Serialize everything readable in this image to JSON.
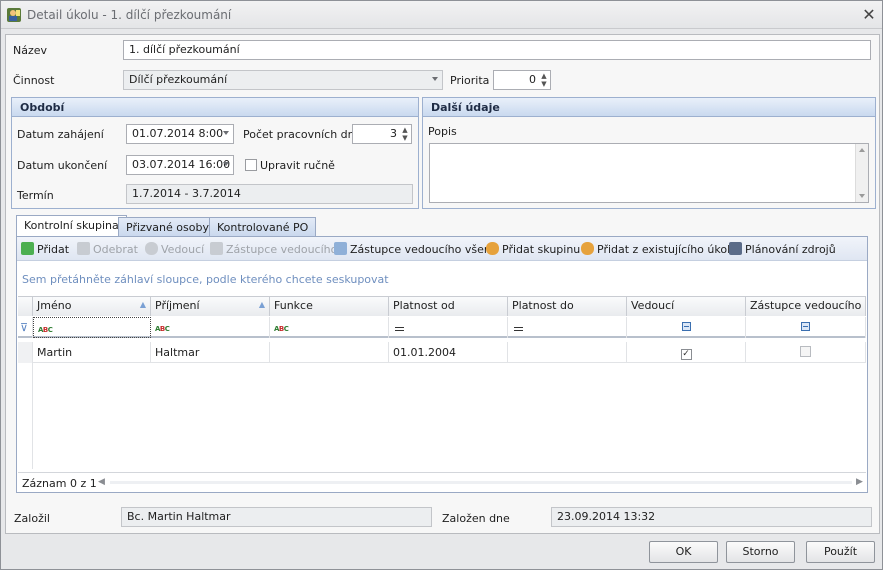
{
  "window": {
    "title": "Detail úkolu - 1. dílčí přezkoumání"
  },
  "form": {
    "nazev_label": "Název",
    "nazev_value": "1. dílčí přezkoumání",
    "cinnost_label": "Činnost",
    "cinnost_value": "Dílčí přezkoumání",
    "priorita_label": "Priorita",
    "priorita_value": "0"
  },
  "obdobi": {
    "title": "Období",
    "zahajeni_label": "Datum zahájení",
    "zahajeni_value": "01.07.2014 8:00",
    "pocet_label": "Počet pracovních dnů",
    "pocet_value": "3",
    "ukonceni_label": "Datum ukončení",
    "ukonceni_value": "03.07.2014 16:00",
    "upravit_label": "Upravit ručně",
    "upravit_checked": false,
    "termin_label": "Termín",
    "termin_value": "1.7.2014 - 3.7.2014"
  },
  "dalsi": {
    "title": "Další údaje",
    "popis_label": "Popis",
    "popis_value": ""
  },
  "tabs": [
    {
      "label": "Kontrolní skupina",
      "active": true
    },
    {
      "label": "Přizvané osoby",
      "active": false
    },
    {
      "label": "Kontrolované PO",
      "active": false
    }
  ],
  "toolbar": {
    "pridat": "Přidat",
    "odebrat": "Odebrat",
    "vedouci": "Vedoucí",
    "zastupce": "Zástupce vedoucího",
    "zastupce_vsem": "Zástupce vedoucího všem",
    "pridat_skupinu": "Přidat skupinu",
    "pridat_z_ukolu": "Přidat z existujícího úkolu",
    "planovani": "Plánování zdrojů"
  },
  "grid": {
    "group_hint": "Sem přetáhněte záhlaví sloupce, podle kterého chcete seskupovat",
    "columns": [
      "Jméno",
      "Příjmení",
      "Funkce",
      "Platnost od",
      "Platnost do",
      "Vedoucí",
      "Zástupce vedoucího"
    ],
    "rows": [
      {
        "jmeno": "Martin",
        "prijmeni": "Haltmar",
        "funkce": "",
        "platnost_od": "01.01.2004",
        "platnost_do": "",
        "vedouci": true,
        "zastupce": false
      }
    ],
    "footer": "Záznam 0 z 1"
  },
  "footer": {
    "zalozil_label": "Založil",
    "zalozil_value": "Bc. Martin Haltmar",
    "zalozen_label": "Založen dne",
    "zalozen_value": "23.09.2014 13:32"
  },
  "buttons": {
    "ok": "OK",
    "storno": "Storno",
    "pouzit": "Použít"
  },
  "colors": {
    "accent": "#3b6fb0",
    "group_header": "#c9d9ef",
    "hint_text": "#6f8fbf"
  }
}
